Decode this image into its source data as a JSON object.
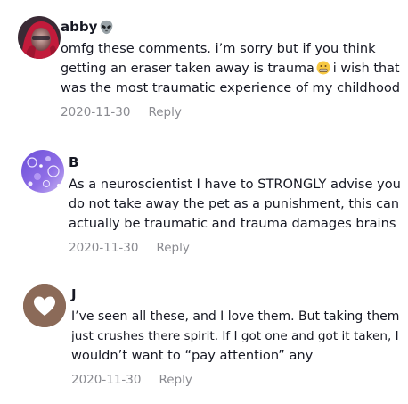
{
  "comments": [
    {
      "username": "abby",
      "username_icon": "alien-icon",
      "avatar": "photo-red-hair-avatar",
      "text_lines": [
        "omfg these comments. i’m sorry but if you think",
        "getting an eraser taken away is trauma",
        "i wish that",
        "was the most traumatic experience of my childhood"
      ],
      "inline_emoji": "grimacing-face-icon",
      "date": "2020-11-30",
      "reply_label": "Reply"
    },
    {
      "username": "B",
      "avatar": "purple-bubbles-avatar",
      "text_lines": [
        "As a neuroscientist I have to STRONGLY advise you",
        "do not take away the pet as a punishment, this can",
        "actually be traumatic and trauma damages brains"
      ],
      "date": "2020-11-30",
      "reply_label": "Reply"
    },
    {
      "username": "J",
      "avatar": "brown-heart-avatar",
      "text_lines": [
        "I’ve seen all these, and I love them. But taking them",
        "just crushes there spirit. If I got one and got it taken, I",
        "wouldn’t want to “pay attention” any"
      ],
      "date": "2020-11-30",
      "reply_label": "Reply"
    }
  ],
  "colors": {
    "text": "#161823",
    "meta": "#8a8b91",
    "heart_avatar_bg": "#8b6a58"
  }
}
